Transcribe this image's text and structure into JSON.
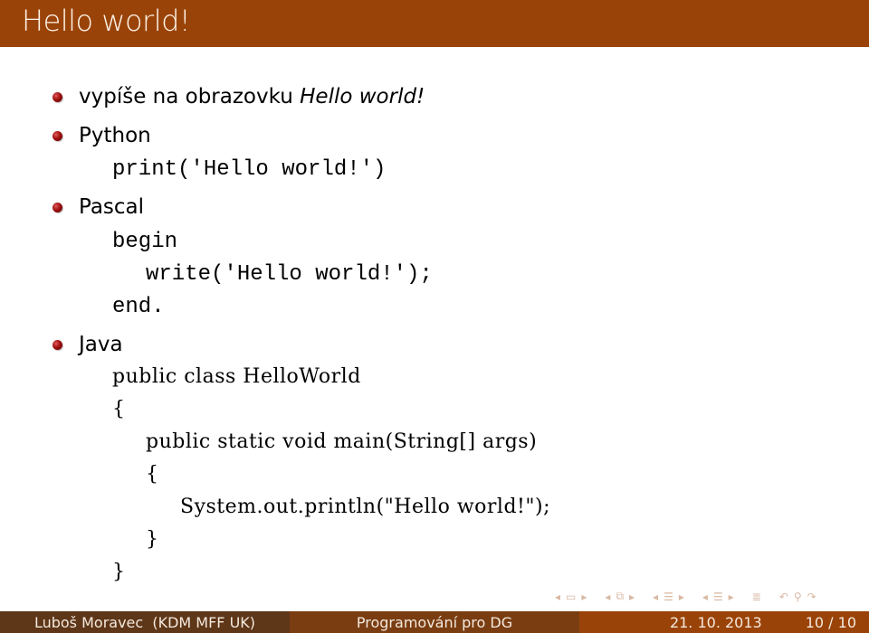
{
  "slide": {
    "title": "Hello world!",
    "bullets": [
      {
        "text": "vypíše na obrazovku ",
        "emphasis": "Hello world!"
      },
      {
        "text": "Python"
      },
      {
        "text": "Pascal"
      },
      {
        "text": "Java"
      }
    ],
    "code": {
      "python": [
        "print('Hello world!')"
      ],
      "pascal": [
        "begin",
        "write('Hello world!');",
        "end."
      ],
      "java": [
        "public class HelloWorld",
        "{",
        "public static void main(String[] args)",
        "{",
        "System.out.println(\"Hello world!\");",
        "}",
        "}"
      ]
    }
  },
  "navigation": {
    "icons": [
      "arrow-left",
      "frame",
      "arrow-right",
      "arrow-left",
      "frames",
      "arrow-right",
      "arrow-left",
      "subsection",
      "arrow-right",
      "arrow-left",
      "section",
      "arrow-right",
      "toc",
      "undo",
      "search",
      "redo"
    ]
  },
  "footer": {
    "author": "Luboš Moravec  (KDM MFF UK)",
    "talk": "Programování pro DG",
    "date": "21. 10. 2013",
    "page": "10 / 10"
  },
  "colors": {
    "title_bar": "#9a4308",
    "footer_left": "#5e3618",
    "footer_mid": "#7a3d12",
    "footer_right": "#9a4308",
    "bullet": "#a01010"
  }
}
